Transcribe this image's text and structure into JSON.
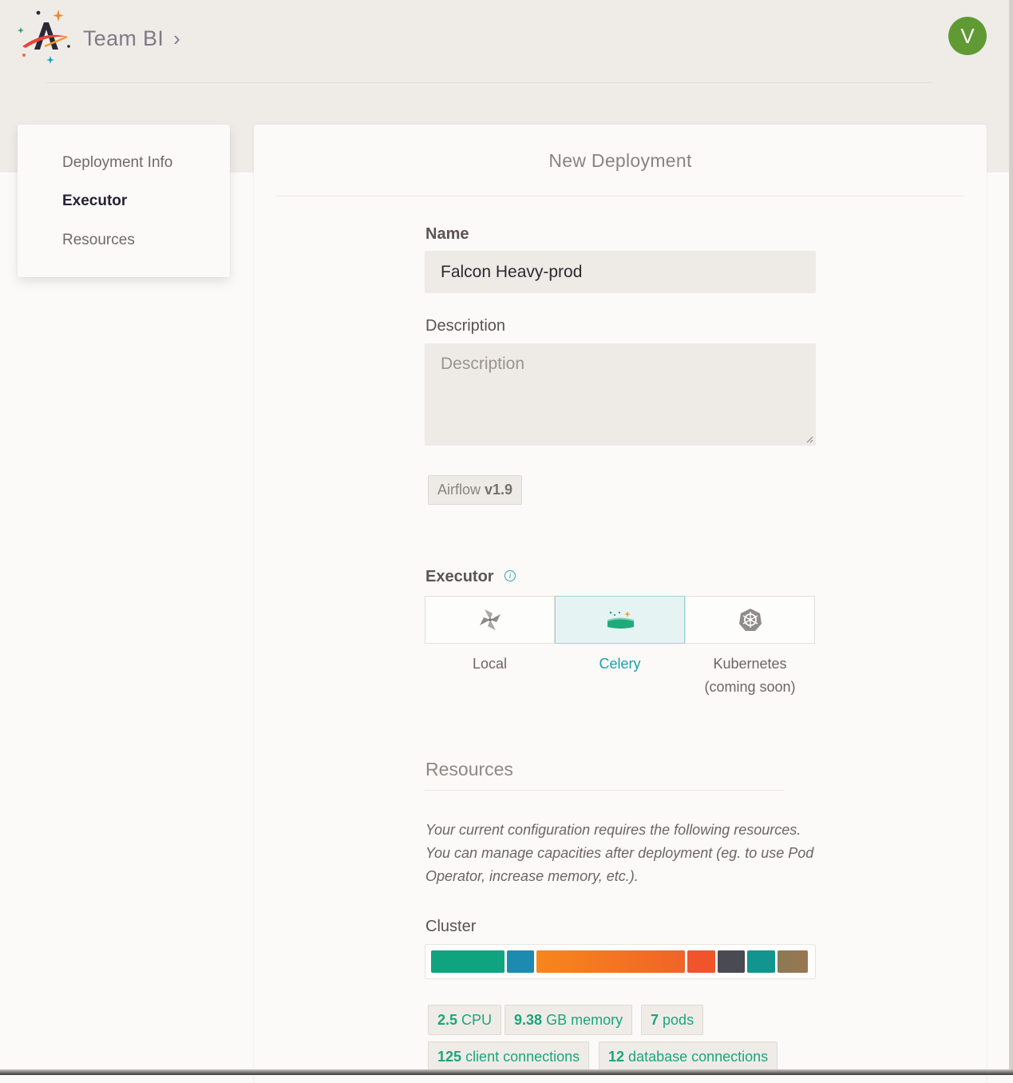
{
  "header": {
    "team_name": "Team BI",
    "chevron": "›",
    "avatar_initial": "V",
    "avatar_color": "#5f9a35"
  },
  "sidebar": {
    "items": [
      {
        "label": "Deployment Info",
        "active": false
      },
      {
        "label": "Executor",
        "active": true
      },
      {
        "label": "Resources",
        "active": false
      }
    ]
  },
  "form": {
    "title": "New Deployment",
    "name_label": "Name",
    "name_value": "Falcon Heavy-prod",
    "description_label": "Description",
    "description_placeholder": "Description",
    "version_prefix": "Airflow",
    "version_value": "v1.9",
    "executor_label": "Executor",
    "info_glyph": "i",
    "executors": [
      {
        "label": "Local",
        "icon": "pinwheel-icon",
        "selected": false
      },
      {
        "label": "Celery",
        "icon": "celery-icon",
        "selected": true
      },
      {
        "label": "Kubernetes",
        "sublabel": "(coming soon)",
        "icon": "kubernetes-icon",
        "selected": false
      }
    ]
  },
  "resources": {
    "title": "Resources",
    "description": "Your current configuration requires the following resources. You can manage capacities after deployment (eg. to use Pod Operator, increase memory, etc.).",
    "cluster_label": "Cluster",
    "cluster_colors": [
      "#10a37f",
      "#1d8bb0",
      "#f7861b",
      "#f0542a",
      "#4a4a52",
      "#12958e",
      "#8a7a55"
    ],
    "stats": [
      {
        "value": "2.5",
        "unit": "CPU"
      },
      {
        "value": "9.38",
        "unit": "GB memory"
      },
      {
        "value": "7",
        "unit": "pods"
      },
      {
        "value": "125",
        "unit": "client connections"
      },
      {
        "value": "12",
        "unit": "database connections"
      }
    ],
    "accent_color": "#19a67d"
  }
}
